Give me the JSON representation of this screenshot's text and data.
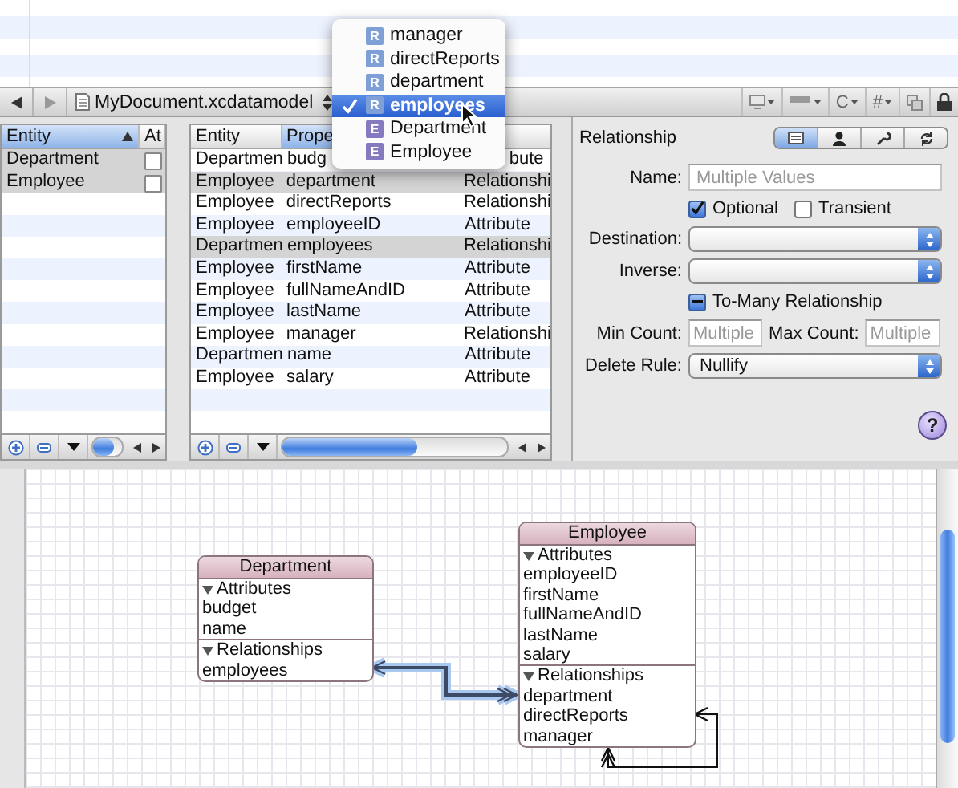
{
  "toolbar": {
    "file": "MyDocument.xcdatamodel",
    "menus": [
      {
        "label": "C"
      },
      {
        "label": "#"
      }
    ]
  },
  "relationship_menu": {
    "items": [
      {
        "kind": "relationship",
        "badge": "R",
        "label": "manager",
        "selected": false
      },
      {
        "kind": "relationship",
        "badge": "R",
        "label": "directReports",
        "selected": false
      },
      {
        "kind": "relationship",
        "badge": "R",
        "label": "department",
        "selected": false
      },
      {
        "kind": "relationship",
        "badge": "R",
        "label": "employees",
        "selected": true
      },
      {
        "kind": "entity",
        "badge": "E",
        "label": "Department",
        "selected": false
      },
      {
        "kind": "entity",
        "badge": "E",
        "label": "Employee",
        "selected": false
      }
    ]
  },
  "entity_table": {
    "columns": [
      {
        "label": "Entity",
        "sorted": true
      },
      {
        "label": "At",
        "sorted": false
      }
    ],
    "rows": [
      {
        "entity": "Department",
        "abstract": false,
        "selected": true
      },
      {
        "entity": "Employee",
        "abstract": false,
        "selected": true
      }
    ]
  },
  "property_table": {
    "columns": [
      {
        "label": "Entity",
        "sorted": false
      },
      {
        "label": "Prope",
        "sorted": true
      }
    ],
    "rows": [
      {
        "entity": "Departmen",
        "property": "budg",
        "type": "bute",
        "selected": false,
        "partly_covered": true
      },
      {
        "entity": "Employee",
        "property": "department",
        "type": "Relationshi",
        "selected": true,
        "partly_covered": false
      },
      {
        "entity": "Employee",
        "property": "directReports",
        "type": "Relationshi",
        "selected": false,
        "partly_covered": false
      },
      {
        "entity": "Employee",
        "property": "employeeID",
        "type": "Attribute",
        "selected": false,
        "partly_covered": false
      },
      {
        "entity": "Departmen",
        "property": "employees",
        "type": "Relationshi",
        "selected": true,
        "partly_covered": false
      },
      {
        "entity": "Employee",
        "property": "firstName",
        "type": "Attribute",
        "selected": false,
        "partly_covered": false
      },
      {
        "entity": "Employee",
        "property": "fullNameAndID",
        "type": "Attribute",
        "selected": false,
        "partly_covered": false
      },
      {
        "entity": "Employee",
        "property": "lastName",
        "type": "Attribute",
        "selected": false,
        "partly_covered": false
      },
      {
        "entity": "Employee",
        "property": "manager",
        "type": "Relationshi",
        "selected": false,
        "partly_covered": false
      },
      {
        "entity": "Departmen",
        "property": "name",
        "type": "Attribute",
        "selected": false,
        "partly_covered": false
      },
      {
        "entity": "Employee",
        "property": "salary",
        "type": "Attribute",
        "selected": false,
        "partly_covered": false
      }
    ]
  },
  "inspector": {
    "title": "Relationship",
    "tabs": [
      {
        "selected": true
      },
      {
        "selected": false
      },
      {
        "selected": false
      },
      {
        "selected": false
      }
    ],
    "fields": [
      {
        "kind": "text",
        "label": "Name:",
        "placeholder": "Multiple Values"
      },
      {
        "kind": "checks",
        "items": [
          {
            "label": "Optional",
            "checked": true,
            "mixed": false
          },
          {
            "label": "Transient",
            "checked": false,
            "mixed": false
          }
        ]
      },
      {
        "kind": "popup",
        "label": "Destination:"
      },
      {
        "kind": "popup",
        "label": "Inverse:"
      },
      {
        "kind": "checks",
        "items": [
          {
            "label": "To-Many Relationship",
            "checked": true,
            "mixed": true
          }
        ]
      },
      {
        "kind": "counts",
        "label": "Min Count:",
        "placeholder": "Multiple",
        "label_2": "Max Count:",
        "placeholder_2": "Multiple"
      },
      {
        "kind": "popup",
        "label": "Delete Rule:",
        "value": "Nullify"
      }
    ],
    "help_button": "?"
  },
  "diagram": {
    "entities": [
      {
        "name": "Department",
        "sections": [
          {
            "title": "Attributes",
            "expanded": true,
            "items": [
              "budget",
              "name"
            ]
          },
          {
            "title": "Relationships",
            "expanded": true,
            "items": [
              "employees"
            ]
          }
        ]
      },
      {
        "name": "Employee",
        "sections": [
          {
            "title": "Attributes",
            "expanded": true,
            "items": [
              "employeeID",
              "firstName",
              "fullNameAndID",
              "lastName",
              "salary"
            ]
          },
          {
            "title": "Relationships",
            "expanded": true,
            "items": [
              "department",
              "directReports",
              "manager"
            ]
          }
        ]
      }
    ],
    "connectors": [
      {
        "selected": true
      },
      {
        "selected": false
      }
    ]
  }
}
